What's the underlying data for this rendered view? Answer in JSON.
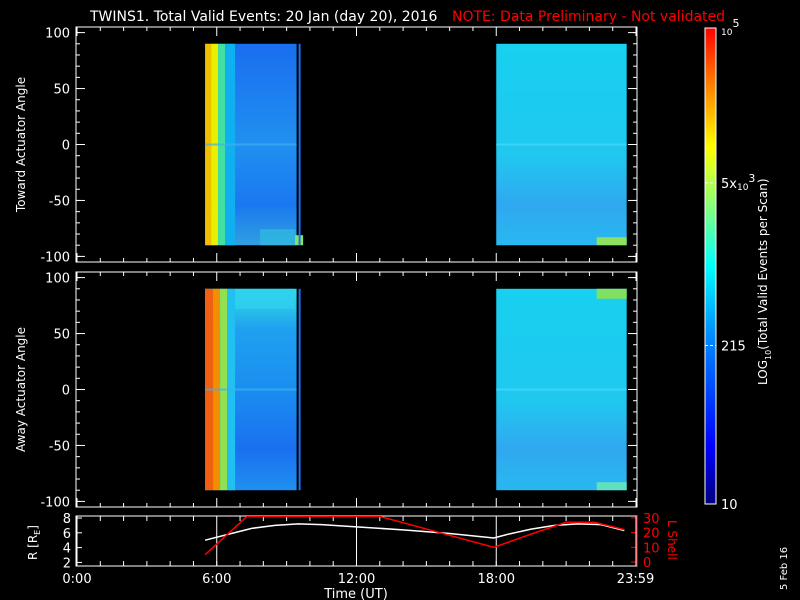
{
  "title": {
    "main": "TWINS1. Total Valid Events: 20 Jan (day  20), 2016",
    "note": "NOTE: Data Preliminary - Not validated",
    "note_color": "#ff0000"
  },
  "date_stamp": "5 Feb 16",
  "chart_data": [
    {
      "type": "heatmap",
      "name": "toward",
      "ylabel": "Toward Actuator Angle",
      "ylim": [
        -105,
        105
      ],
      "yticks": [
        "100",
        "50",
        "0",
        "-50",
        "-100"
      ],
      "ytick_values": [
        100,
        50,
        0,
        -50,
        -100
      ],
      "xlim_hours": [
        0,
        24
      ],
      "data_blocks": [
        {
          "t_start": 5.5,
          "t_end": 9.6,
          "angle_range": [
            -90,
            90
          ],
          "approx_counts": "200-20000, highest (yellow) near 5.5-6.5 h"
        },
        {
          "t_start": 18.0,
          "t_end": 23.6,
          "angle_range": [
            -90,
            90
          ],
          "approx_counts": "~500-1000"
        }
      ]
    },
    {
      "type": "heatmap",
      "name": "away",
      "ylabel": "Away Actuator Angle",
      "ylim": [
        -105,
        105
      ],
      "yticks": [
        "100",
        "50",
        "0",
        "-50",
        "-100"
      ],
      "ytick_values": [
        100,
        50,
        0,
        -50,
        -100
      ],
      "xlim_hours": [
        0,
        24
      ],
      "data_blocks": [
        {
          "t_start": 5.5,
          "t_end": 9.6,
          "angle_range": [
            -90,
            90
          ],
          "approx_counts": "200-50000, highest (orange) near 5.5-6.5 h"
        },
        {
          "t_start": 18.0,
          "t_end": 23.6,
          "angle_range": [
            -90,
            90
          ],
          "approx_counts": "~500-1500"
        }
      ]
    },
    {
      "type": "line",
      "name": "orbit",
      "ylabel": "R [R",
      "ylabel_sub": "E",
      "ylabel_close": "]",
      "ylabel_right": "L Shell",
      "yticks": [
        "8",
        "6",
        "4",
        "2"
      ],
      "ytick_values": [
        8,
        6,
        4,
        2
      ],
      "yticks_right": [
        "30",
        "20",
        "10",
        "0"
      ],
      "ytick_right_values": [
        30,
        20,
        10,
        0
      ],
      "ylim": [
        1.6,
        8.2
      ],
      "ylim_right": [
        0,
        30
      ],
      "xlabel": "Time (UT)",
      "xticks": [
        "0:00",
        "6:00",
        "12:00",
        "18:00",
        "23:59"
      ],
      "xtick_values": [
        0,
        6,
        12,
        18,
        23.98
      ],
      "series": [
        {
          "name": "R",
          "color": "#ffffff",
          "axis": "left",
          "x": [
            5.5,
            6.5,
            7.5,
            8.5,
            9.5,
            10.5,
            12,
            14,
            16,
            17.9,
            18.5,
            19.5,
            20.5,
            21.5,
            22.5,
            23.5
          ],
          "y": [
            5.0,
            5.8,
            6.6,
            7.0,
            7.2,
            7.1,
            6.8,
            6.4,
            5.9,
            5.3,
            5.8,
            6.5,
            7.0,
            7.2,
            7.1,
            6.3
          ]
        },
        {
          "name": "L Shell",
          "color": "#ff0000",
          "axis": "right",
          "x": [
            5.5,
            7.3,
            13.0,
            17.9,
            19.5,
            21.0,
            22.2,
            23.5
          ],
          "y": [
            5,
            31,
            31,
            10,
            19,
            27,
            27,
            22
          ]
        }
      ]
    }
  ],
  "colorbar": {
    "label": "LOG",
    "label_sub": "10",
    "label_rest": "(Total Valid Events per Scan)",
    "ticks": [
      {
        "base": "10",
        "exp": "5",
        "prefix": "",
        "value": 100000
      },
      {
        "base": "10",
        "exp": "3",
        "prefix": "5x",
        "value": 5000
      },
      {
        "base": "",
        "exp": "",
        "prefix": "215",
        "value": 215
      },
      {
        "base": "",
        "exp": "",
        "prefix": "10",
        "value": 10
      }
    ],
    "range": [
      10,
      100000
    ],
    "scale": "log"
  }
}
